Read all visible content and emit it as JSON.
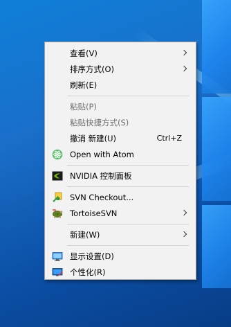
{
  "menu": {
    "items": [
      {
        "label": "查看(V)",
        "submenu": true
      },
      {
        "label": "排序方式(O)",
        "submenu": true
      },
      {
        "label": "刷新(E)"
      },
      {
        "label": "粘贴(P)",
        "disabled": true
      },
      {
        "label": "粘贴快捷方式(S)",
        "disabled": true
      },
      {
        "label": "撤消 新建(U)",
        "shortcut": "Ctrl+Z"
      },
      {
        "label": "Open with Atom",
        "icon": "atom-icon"
      },
      {
        "label": "NVIDIA 控制面板",
        "icon": "nvidia-icon"
      },
      {
        "label": "SVN Checkout...",
        "icon": "svn-checkout-icon"
      },
      {
        "label": "TortoiseSVN",
        "icon": "tortoisesvn-icon",
        "submenu": true
      },
      {
        "label": "新建(W)",
        "submenu": true
      },
      {
        "label": "显示设置(D)",
        "icon": "display-settings-icon"
      },
      {
        "label": "个性化(R)",
        "icon": "personalize-icon"
      }
    ]
  },
  "colors": {
    "menu_background": "#f2f2f2",
    "disabled_text": "#6d6d6d",
    "desktop_blue": "#1a6fc9"
  }
}
